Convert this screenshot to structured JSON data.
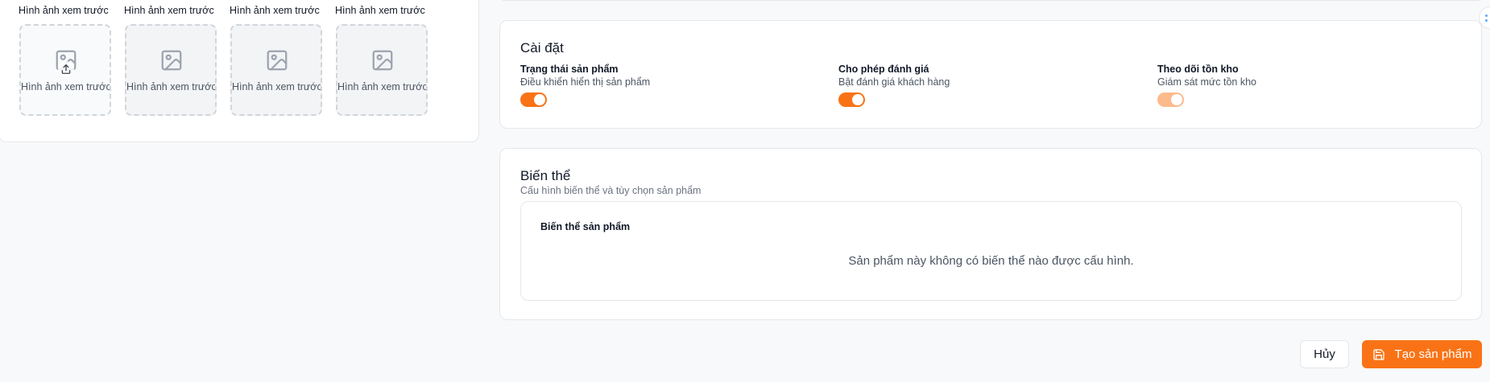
{
  "images": {
    "items": [
      {
        "caption": "Hình ảnh xem trước",
        "alt": "Hình ảnh xem trước",
        "has_upload": true
      },
      {
        "caption": "Hình ảnh xem trước",
        "alt": "Hình ảnh xem trước",
        "has_upload": false
      },
      {
        "caption": "Hình ảnh xem trước",
        "alt": "Hình ảnh xem trước",
        "has_upload": false
      },
      {
        "caption": "Hình ảnh xem trước",
        "alt": "Hình ảnh xem trước",
        "has_upload": false
      }
    ]
  },
  "settings": {
    "title": "Cài đặt",
    "items": [
      {
        "title": "Trạng thái sản phẩm",
        "description": "Điều khiển hiển thị sản phẩm",
        "enabled": true
      },
      {
        "title": "Cho phép đánh giá",
        "description": "Bật đánh giá khách hàng",
        "enabled": true
      },
      {
        "title": "Theo dõi tồn kho",
        "description": "Giám sát mức tồn kho",
        "enabled": true,
        "dimmed": true
      }
    ]
  },
  "variants": {
    "title": "Biến thể",
    "subtitle": "Cấu hình biến thể và tùy chọn sản phẩm",
    "section_title": "Biến thể sản phẩm",
    "empty_message": "Sản phẩm này không có biến thể nào được cấu hình."
  },
  "footer": {
    "cancel_label": "Hủy",
    "create_label": "Tạo sản phẩm"
  },
  "colors": {
    "accent": "#f97316",
    "accent_dim": "#fdba8c",
    "border": "#e5e7eb",
    "background": "#f8f9fa"
  }
}
